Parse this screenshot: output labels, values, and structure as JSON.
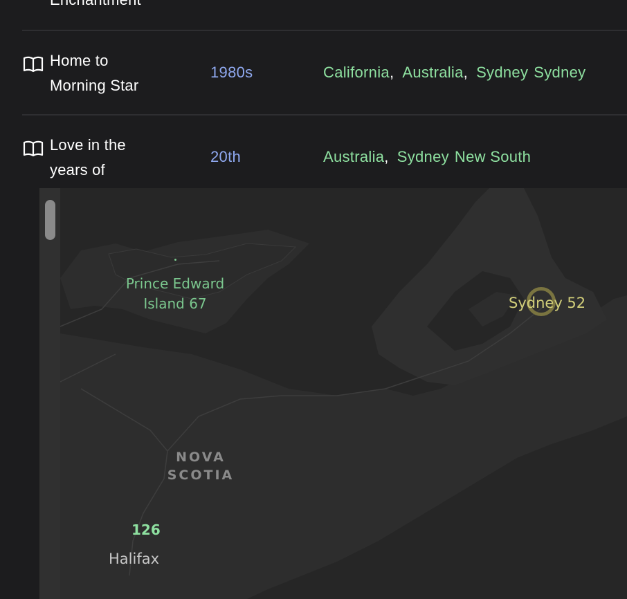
{
  "rows": [
    {
      "title_lines": [
        "Enchantment"
      ]
    },
    {
      "title_lines": [
        "Home to",
        "Morning Star"
      ],
      "era": "1980s",
      "places": [
        "California",
        "Australia",
        "Sydney",
        "Sydney"
      ]
    },
    {
      "title_lines": [
        "Love in the",
        "years of"
      ],
      "era": "20th",
      "places": [
        "Australia",
        "Sydney",
        "New South"
      ]
    }
  ],
  "map": {
    "labels": {
      "pei_line1": "Prince Edward",
      "pei_line2": "Island 67",
      "sydney": "Sydney 52",
      "nova_line1": "NOVA",
      "nova_line2": "SCOTIA",
      "cluster_count": "126",
      "halifax": "Halifax"
    }
  },
  "colors": {
    "background": "#1c1c1e",
    "era_accent": "#8fa8ef",
    "place_accent": "#8ee0a0",
    "map_water": "#262626",
    "map_land": "#2d2d2d",
    "sydney_marker": "#d2cf7a"
  },
  "icons": {
    "row_icon": "open-book-icon"
  }
}
